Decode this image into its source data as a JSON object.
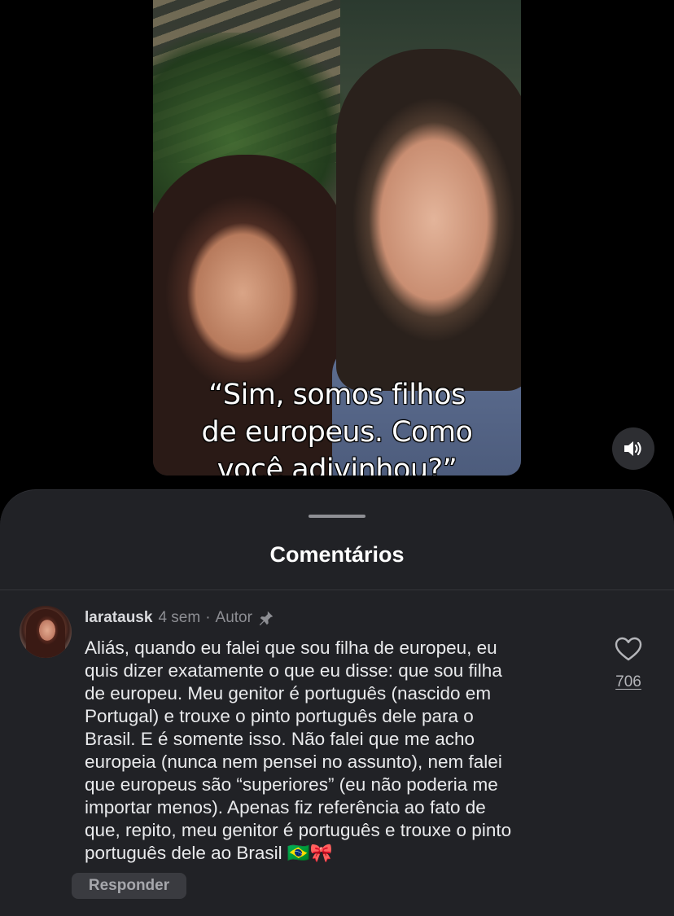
{
  "video": {
    "caption": "“Sim, somos filhos\nde europeus. Como\nvocê adivinhou?”",
    "mute_icon": "speaker-icon"
  },
  "comments_sheet": {
    "title": "Comentários",
    "comment": {
      "username": "laratausk",
      "age": "4 sem",
      "separator": "·",
      "author_badge": "Autor",
      "pin_icon": "pin-icon",
      "text": "Aliás, quando eu falei que sou filha de europeu, eu\nquis dizer exatamente o que eu disse: que sou filha\nde europeu. Meu genitor é português (nascido em\nPortugal) e trouxe o pinto português dele para o\nBrasil. E é somente isso. Não falei que me acho\neuropeia (nunca nem pensei no assunto), nem falei\nque europeus são “superiores” (eu não poderia me\nimportar menos). Apenas fiz referência ao fato de\nque, repito, meu genitor é português e trouxe o pinto\nportuguês dele ao Brasil 🇧🇷🎀",
      "likes": "706",
      "reply_label": "Responder"
    }
  },
  "colors": {
    "sheet_bg": "#212226",
    "text_primary": "#e9eaec",
    "text_secondary": "#8d8e93"
  }
}
